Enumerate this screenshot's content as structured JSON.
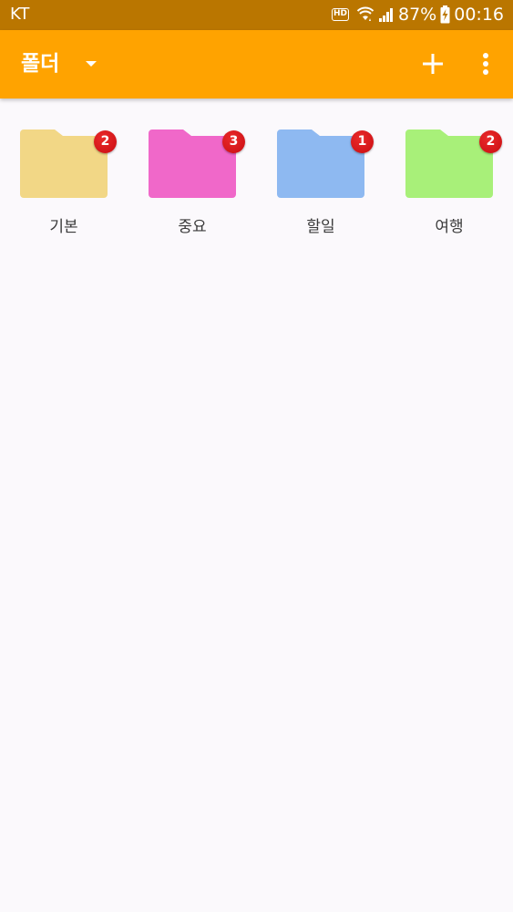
{
  "status_bar": {
    "carrier": "KT",
    "battery": "87%",
    "time": "00:16",
    "hd_label": "HD"
  },
  "app_bar": {
    "title": "폴더",
    "colors": {
      "app_bar": "#FFA300",
      "status_bar": "#BA7600",
      "background": "#FBF9FC"
    }
  },
  "folders": [
    {
      "name": "기본",
      "count": "2",
      "color": "#F2D786"
    },
    {
      "name": "중요",
      "count": "3",
      "color": "#F068C9"
    },
    {
      "name": "할일",
      "count": "1",
      "color": "#8EB9F1"
    },
    {
      "name": "여행",
      "count": "2",
      "color": "#A8F079"
    }
  ]
}
